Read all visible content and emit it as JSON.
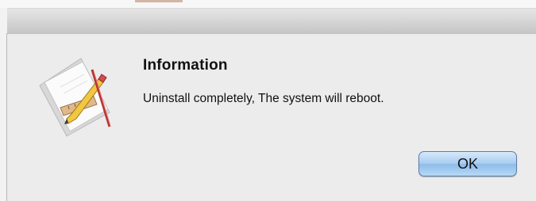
{
  "dialog": {
    "title": "Information",
    "message": "Uninstall completely, The system will reboot.",
    "ok_label": "OK",
    "icon": "script-editor-icon"
  }
}
